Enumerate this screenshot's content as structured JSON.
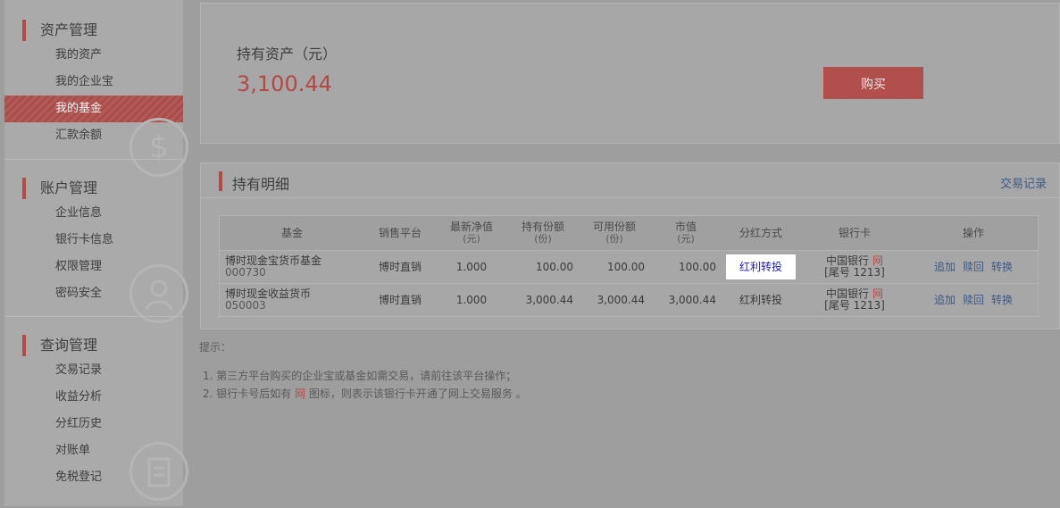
{
  "sidebar": {
    "sections": [
      {
        "title": "资产管理",
        "items": [
          "我的资产",
          "我的企业宝",
          "我的基金",
          "汇款余额"
        ]
      },
      {
        "title": "账户管理",
        "items": [
          "企业信息",
          "银行卡信息",
          "权限管理",
          "密码安全"
        ]
      },
      {
        "title": "查询管理",
        "items": [
          "交易记录",
          "收益分析",
          "分红历史",
          "对账单",
          "免税登记"
        ]
      }
    ],
    "watermarks": [
      "$",
      "",
      ""
    ]
  },
  "assets": {
    "label": "持有资产（元）",
    "value": "3,100.44",
    "buy_label": "购买"
  },
  "holdings": {
    "title": "持有明细",
    "link": "交易记录",
    "headers": {
      "fund": "基金",
      "platform": "销售平台",
      "nav": "最新净值",
      "nav_unit": "(元)",
      "shares": "持有份额",
      "shares_unit": "(份)",
      "avail": "可用份额",
      "avail_unit": "(份)",
      "mv": "市值",
      "mv_unit": "(元)",
      "div": "分红方式",
      "bank": "银行卡",
      "ops": "操作"
    },
    "rows": [
      {
        "name": "博时现金宝货币基金",
        "code": "000730",
        "platform": "博时直销",
        "nav": "1.000",
        "shares": "100.00",
        "avail": "100.00",
        "mv": "100.00",
        "div": "红利转投",
        "bank": "中国银行",
        "net": "网",
        "tail": "[尾号 1213]",
        "op1": "追加",
        "op2": "赎回",
        "op3": "转换"
      },
      {
        "name": "博时现金收益货币",
        "code": "050003",
        "platform": "博时直销",
        "nav": "1.000",
        "shares": "3,000.44",
        "avail": "3,000.44",
        "mv": "3,000.44",
        "div": "红利转投",
        "bank": "中国银行",
        "net": "网",
        "tail": "[尾号 1213]",
        "op1": "追加",
        "op2": "赎回",
        "op3": "转换"
      }
    ]
  },
  "tips": {
    "title": "提示：",
    "line1": "1.  第三方平台购买的企业宝或基金如需交易，请前往该平台操作；",
    "line2_a": "2.  银行卡号后如有 ",
    "line2_net": "网",
    "line2_b": " 图标，则表示该银行卡开通了网上交易服务 。"
  }
}
